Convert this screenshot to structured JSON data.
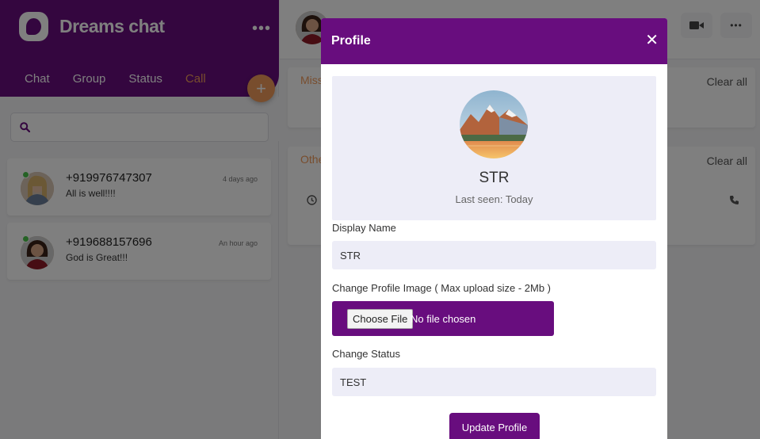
{
  "app": {
    "name": "Dreams chat",
    "menu_glyph": "•••"
  },
  "sidebar": {
    "tabs": [
      {
        "label": "Chat"
      },
      {
        "label": "Group"
      },
      {
        "label": "Status"
      },
      {
        "label": "Call",
        "active": true
      }
    ],
    "fab_glyph": "+",
    "search": {
      "placeholder": ""
    },
    "calls": [
      {
        "name": "+919976747307",
        "message": "All is well!!!!",
        "time": "4 days ago",
        "online": true
      },
      {
        "name": "+919688157696",
        "message": "God is Great!!!",
        "time": "An hour ago",
        "online": true
      }
    ]
  },
  "main": {
    "sections": [
      {
        "label": "Missed",
        "clear": "Clear all"
      },
      {
        "label": "Other",
        "clear": "Clear all"
      }
    ],
    "menu_glyph": "•••"
  },
  "modal": {
    "title": "Profile",
    "close_glyph": "✕",
    "profile": {
      "name": "STR",
      "last_seen": "Last seen: Today"
    },
    "display_name_label": "Display Name",
    "display_name_value": "STR",
    "image_label": "Change Profile Image ( Max upload size - 2Mb )",
    "file_button": "Choose File",
    "file_status": "No file chosen",
    "status_label": "Change Status",
    "status_value": "TEST",
    "submit": "Update Profile"
  },
  "colors": {
    "brand_purple": "#680d7e",
    "accent_orange": "#f19a5a",
    "online_green": "#4bc54b"
  },
  "icons": [
    "search-icon",
    "plus-icon",
    "clock-icon",
    "phone-icon",
    "video-icon",
    "more-icon",
    "close-icon"
  ]
}
